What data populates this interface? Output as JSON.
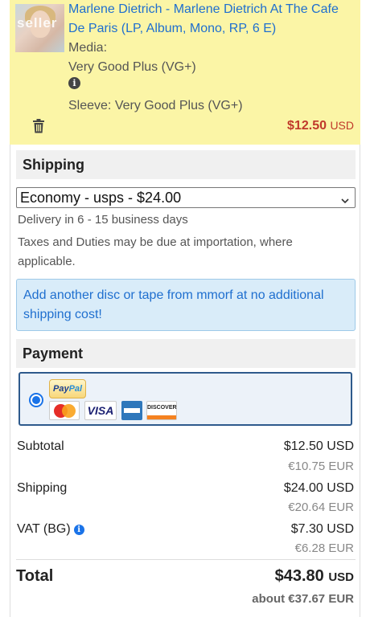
{
  "item": {
    "title": "Marlene Dietrich - Marlene Dietrich At The Cafe De Paris (LP, Album, Mono, RP, 6 E)",
    "thumb_watermark": "seller",
    "media_label": "Media:",
    "media_value": "Very Good Plus (VG+)",
    "sleeve": "Sleeve: Very Good Plus (VG+)",
    "price": "$12.50",
    "currency": "USD"
  },
  "shipping": {
    "heading": "Shipping",
    "selected_option": "Economy - usps - $24.00",
    "delivery": "Delivery in 6 - 15 business days",
    "taxes_note": "Taxes and Duties may be due at importation, where applicable.",
    "notice": "Add another disc or tape from mmorf at no additional shipping cost!"
  },
  "payment": {
    "heading": "Payment",
    "paypal_1": "Pay",
    "paypal_2": "Pal",
    "visa": "VISA",
    "discover": "DISCOVER"
  },
  "summary": {
    "subtotal_label": "Subtotal",
    "subtotal_usd": "$12.50 USD",
    "subtotal_eur": "€10.75 EUR",
    "shipping_label": "Shipping",
    "shipping_usd": "$24.00 USD",
    "shipping_eur": "€20.64 EUR",
    "vat_label": "VAT (BG)",
    "vat_usd": "$7.30 USD",
    "vat_eur": "€6.28 EUR",
    "total_label": "Total",
    "total_amount": "$43.80",
    "total_currency": "USD",
    "about": "about €37.67 EUR"
  },
  "colors": {
    "item_bg": "#fbf5a6",
    "link": "#1f6fcf",
    "price": "#c0392b",
    "notice_bg": "#d9ecf9",
    "accent": "#1a73e8"
  }
}
